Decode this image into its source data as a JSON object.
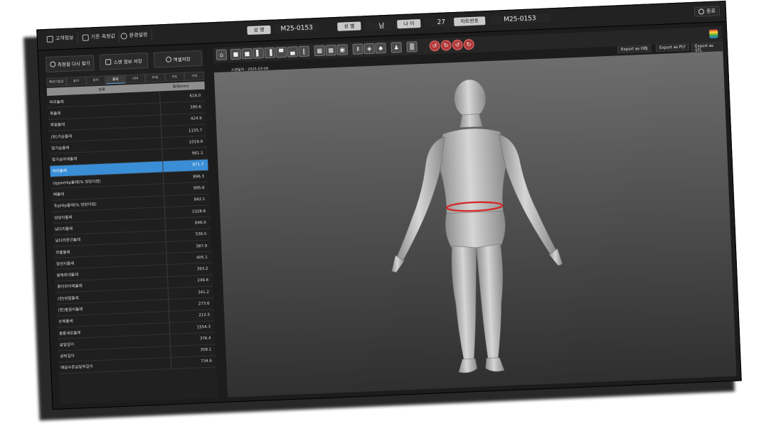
{
  "header": {
    "menu": [
      "고객정보",
      "기준 측정값",
      "환경설정"
    ],
    "name_label": "성 명",
    "name_value": "M25-0153",
    "gender_label": "성 별",
    "gender_value": "남",
    "age_label": "나 이",
    "age_value": "27",
    "chart_no_label": "차트번호",
    "chart_no_value": "M25-0153",
    "exit_label": "종료"
  },
  "left_panel": {
    "buttons": [
      "측정점 다시 찾기",
      "스캔 정보 저장",
      "엑셀저장"
    ],
    "tabs": [
      "측정기본값",
      "높이",
      "길이",
      "둘레",
      "너비",
      "두께",
      "각도",
      "거리"
    ],
    "active_tab": 3,
    "column_headers": [
      "항목",
      "둘레(mm)"
    ],
    "rows": [
      {
        "label": "머리둘레",
        "value": "616.0"
      },
      {
        "label": "목둘레",
        "value": "390.6"
      },
      {
        "label": "목밑둘레",
        "value": "424.9"
      },
      {
        "label": "(뒤)가슴둘레",
        "value": "1155.7"
      },
      {
        "label": "젖가슴둘레",
        "value": "1019.9"
      },
      {
        "label": "젖가슴아래둘레",
        "value": "961.1"
      },
      {
        "label": "허리둘레",
        "value": "871.7",
        "selected": true
      },
      {
        "label": "UpperHip둘레(% 엉덩이점)",
        "value": "896.3"
      },
      {
        "label": "배둘레",
        "value": "895.6"
      },
      {
        "label": "TopHip둘레(% 엉덩이점)",
        "value": "842.1"
      },
      {
        "label": "엉덩이둘레",
        "value": "1028.8"
      },
      {
        "label": "넙다리둘레",
        "value": "646.0"
      },
      {
        "label": "넙다리중간둘레",
        "value": "536.5"
      },
      {
        "label": "무릎둘레",
        "value": "387.9"
      },
      {
        "label": "장딴지둘레",
        "value": "405.1"
      },
      {
        "label": "발목최대둘레",
        "value": "393.2"
      },
      {
        "label": "종아리아래둘레",
        "value": "249.6"
      },
      {
        "label": "(한)위팔둘레",
        "value": "341.2"
      },
      {
        "label": "(한)팔꿈치둘레",
        "value": "273.6"
      },
      {
        "label": "손목둘레",
        "value": "212.5"
      },
      {
        "label": "몸통세로둘레",
        "value": "1554.3"
      },
      {
        "label": "샅앞길이",
        "value": "376.4"
      },
      {
        "label": "샅뒤길이",
        "value": "358.1"
      },
      {
        "label": "배꼽수준샅앞뒤길이",
        "value": "734.6"
      }
    ]
  },
  "viewport": {
    "export_buttons": [
      "Export as OBJ",
      "Export as PLY",
      "Export as STL"
    ],
    "scan_date": "스캔일자 : 2025-03-09",
    "accent_color": "#3a8ed6",
    "waist_ring_color": "#d42a2a"
  }
}
